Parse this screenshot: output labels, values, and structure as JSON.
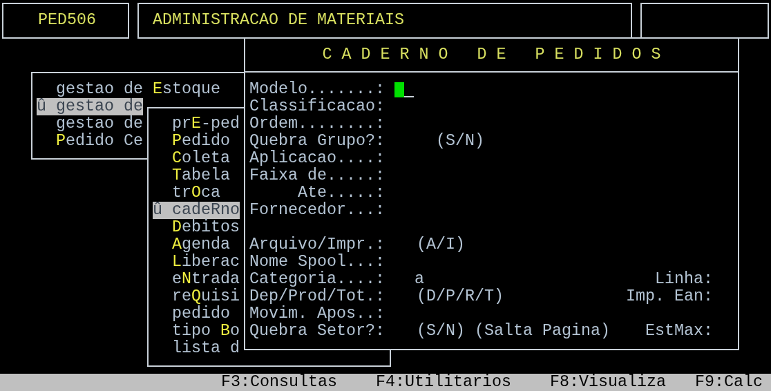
{
  "header": [
    {
      "text": "PED506"
    },
    {
      "text": "ADMINISTRACAO DE MATERIAIS"
    }
  ],
  "menus": [
    {
      "items": [
        {
          "before": "gestao de ",
          "hotkey": "E",
          "after": "stoque",
          "selected": false
        },
        {
          "before": "û gestao de",
          "selected": true
        },
        {
          "before": "gestao de",
          "selected": false
        },
        {
          "hotkey": "P",
          "after": "edido Ce",
          "selected": false
        }
      ]
    },
    {
      "items": [
        {
          "before": "pr",
          "hotkey": "E",
          "after": "-ped",
          "selected": false
        },
        {
          "hotkey": "P",
          "after": "edido",
          "selected": false
        },
        {
          "hotkey": "C",
          "after": "oleta",
          "selected": false
        },
        {
          "hotkey": "T",
          "after": "abela",
          "selected": false
        },
        {
          "before": "tr",
          "hotkey": "O",
          "after": "ca",
          "selected": false
        },
        {
          "before": "û cadeRno",
          "selected": true
        },
        {
          "hotkey": "D",
          "after": "ebitos",
          "selected": false
        },
        {
          "hotkey": "A",
          "after": "genda",
          "selected": false
        },
        {
          "hotkey": "L",
          "after": "iberac",
          "selected": false
        },
        {
          "before": "e",
          "hotkey": "N",
          "after": "trada",
          "selected": false
        },
        {
          "before": "re",
          "hotkey": "Q",
          "after": "uisi",
          "selected": false
        },
        {
          "before": "pedido",
          "selected": false
        },
        {
          "before": "tipo ",
          "hotkey": "B",
          "after": "o",
          "selected": false
        },
        {
          "before": "lista d",
          "selected": false
        }
      ]
    }
  ],
  "form": {
    "title": "C A D E R N O   D E   P E D I D O S",
    "sections": [
      {
        "fields": [
          {
            "label": "Modelo.......:",
            "focused": true
          },
          {
            "label": "Classificacao:",
            "focused": false
          },
          {
            "label": "Ordem........:",
            "focused": false
          },
          {
            "label": "Quebra Grupo?:",
            "hint": "(S/N)",
            "focused": false
          },
          {
            "label": "Aplicacao....:",
            "focused": false
          },
          {
            "label": "Faixa de.....:",
            "focused": false
          },
          {
            "label": "Ate.....:",
            "focused": false
          },
          {
            "label": "Fornecedor...:",
            "focused": false
          }
        ]
      },
      {
        "fields": [
          {
            "label": "Arquivo/Impr.:",
            "hint": "(A/I)",
            "focused": false
          },
          {
            "label": "Nome Spool...:",
            "focused": false
          },
          {
            "label": "Categoria....:",
            "value": "a",
            "right_label": "Linha:",
            "focused": false
          },
          {
            "label": "Dep/Prod/Tot.:",
            "hint": "(D/P/R/T)",
            "right_label": "Imp. Ean:",
            "focused": false
          },
          {
            "label": "Movim. Apos..:",
            "focused": false
          },
          {
            "label": "Quebra Setor?:",
            "hint": "(S/N) (Salta Pagina)",
            "right_label": "EstMax:",
            "focused": false
          }
        ]
      }
    ]
  },
  "status_bar": [
    "F3:Consultas",
    "F4:Utilitarios",
    "F8:Visualiza",
    "F9:Calc"
  ]
}
